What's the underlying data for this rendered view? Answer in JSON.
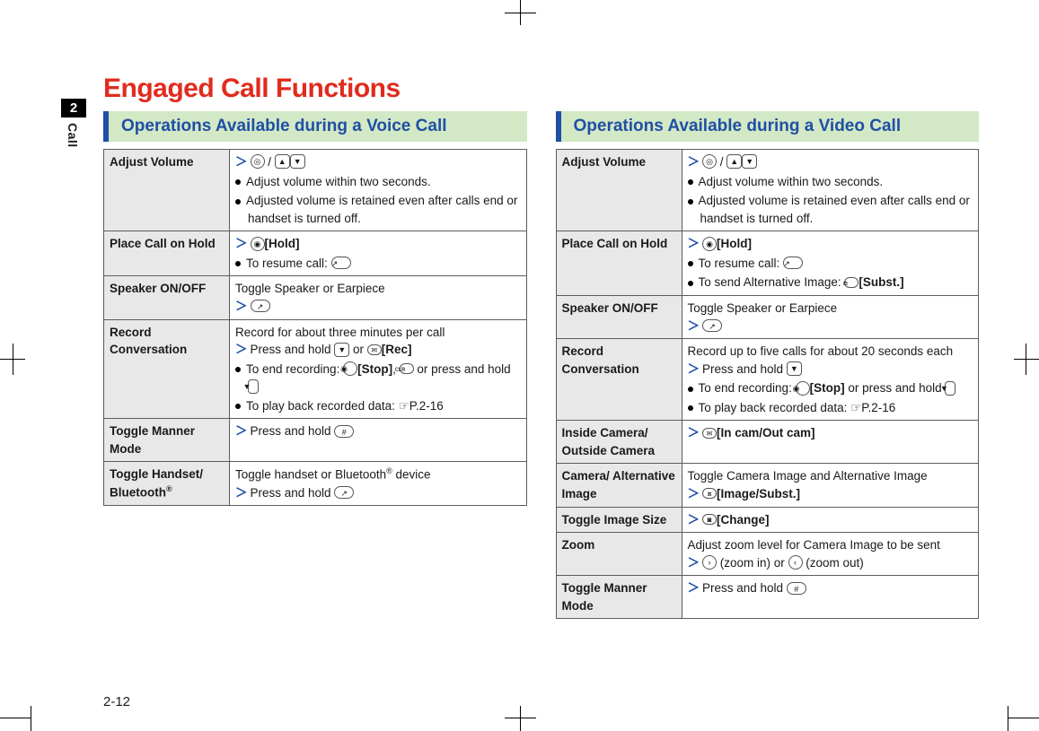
{
  "tab": {
    "num": "2",
    "label": "Call"
  },
  "title": "Engaged Call Functions",
  "pagenum": "2-12",
  "section_voice": "Operations Available during a Voice Call",
  "section_video": "Operations Available during a Video Call",
  "voice": {
    "adjust_volume": {
      "fn": "Adjust Volume",
      "b1": "Adjust volume within two seconds.",
      "b2": "Adjusted volume is retained even after calls end or handset is turned off."
    },
    "hold": {
      "fn": "Place Call on Hold",
      "label": "[Hold]",
      "b1": "To resume call: "
    },
    "speaker": {
      "fn": "Speaker ON/OFF",
      "desc": "Toggle Speaker or Earpiece"
    },
    "record": {
      "fn": "Record Conversation",
      "desc": "Record for about three minutes per call",
      "press": "Press and hold ",
      "or": " or ",
      "rec": "[Rec]",
      "end_a": "To end recording: ",
      "stop": "[Stop]",
      "end_b": ", ",
      "end_c": " or press and hold ",
      "play": "To play back recorded data: ",
      "ref": "P.2-16"
    },
    "manner": {
      "fn": "Toggle Manner Mode",
      "press": "Press and hold "
    },
    "bt": {
      "fn": "Toggle Handset/ Bluetooth",
      "desc": "Toggle handset or Bluetooth",
      "device": " device",
      "press": "Press and hold "
    }
  },
  "video": {
    "adjust_volume": {
      "fn": "Adjust Volume",
      "b1": "Adjust volume within two seconds.",
      "b2": "Adjusted volume is retained even after calls end or handset is turned off."
    },
    "hold": {
      "fn": "Place Call on Hold",
      "label": "[Hold]",
      "b1": "To resume call: ",
      "b2": "To send Alternative Image: ",
      "subst": "[Subst.]"
    },
    "speaker": {
      "fn": "Speaker ON/OFF",
      "desc": "Toggle Speaker or Earpiece"
    },
    "record": {
      "fn": "Record Conversation",
      "desc": "Record up to five calls for about 20 seconds each",
      "press": "Press and hold ",
      "end_a": "To end recording: ",
      "stop": "[Stop]",
      "end_b": " or press and hold ",
      "play": "To play back recorded data: ",
      "ref": "P.2-16"
    },
    "cam": {
      "fn": "Inside Camera/ Outside Camera",
      "label": "[In cam/Out cam]"
    },
    "alt": {
      "fn": "Camera/ Alternative Image",
      "desc": "Toggle Camera Image and Alternative Image",
      "label": "[Image/Subst.]"
    },
    "size": {
      "fn": "Toggle Image Size",
      "label": "[Change]"
    },
    "zoom": {
      "fn": "Zoom",
      "desc": "Adjust zoom level for Camera Image to be sent",
      "in": " (zoom in) or ",
      "out": " (zoom out)"
    },
    "manner": {
      "fn": "Toggle Manner Mode",
      "press": "Press and hold "
    }
  }
}
